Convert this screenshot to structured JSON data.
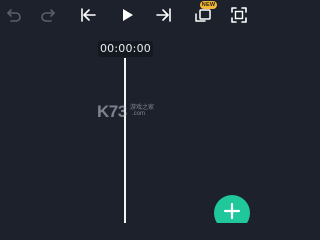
{
  "toolbar": {
    "undo_icon": "undo-icon",
    "redo_icon": "redo-icon",
    "skip_start_icon": "skip-to-start-icon",
    "play_icon": "play-icon",
    "skip_end_icon": "skip-to-end-icon",
    "effects_icon": "keyframe-icon",
    "fullscreen_icon": "fullscreen-icon",
    "new_badge": "NEW"
  },
  "preview": {
    "timecode": "00:00:00"
  },
  "watermark": {
    "brand": "K73",
    "site_name": "游戏之家",
    "domain": ".com"
  },
  "actions": {
    "add_icon": "plus-icon"
  },
  "colors": {
    "background": "#1d212b",
    "icon_active": "#ffffff",
    "icon_disabled": "#5a5f6b",
    "accent": "#1fc79b",
    "badge": "#f0b63c"
  }
}
